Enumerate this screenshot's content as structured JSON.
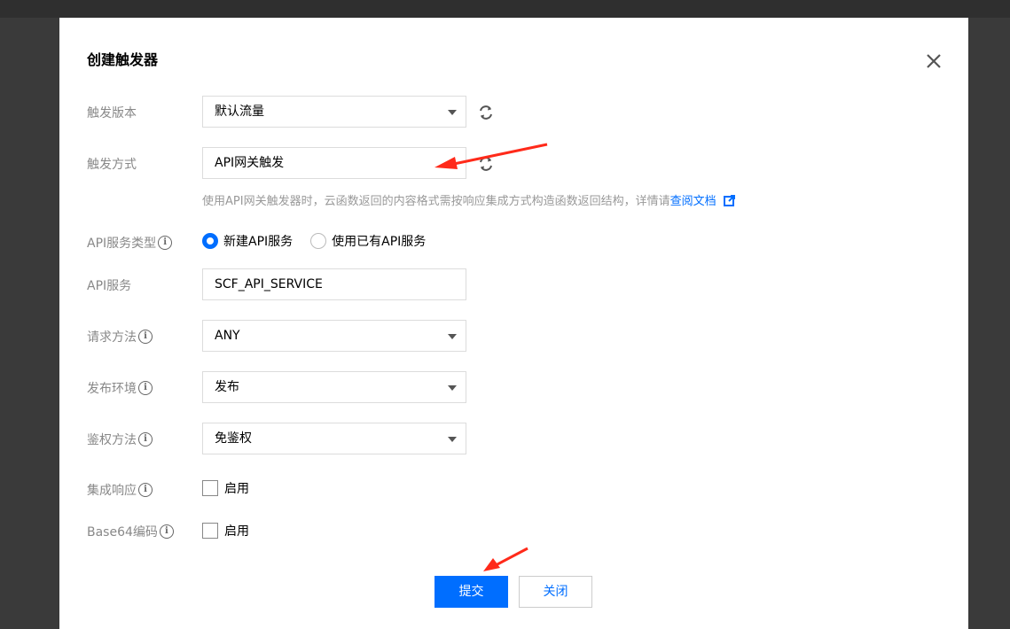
{
  "dialog": {
    "title": "创建触发器",
    "close_icon": "close-icon"
  },
  "form": {
    "trigger_version": {
      "label": "触发版本",
      "value": "默认流量"
    },
    "trigger_method": {
      "label": "触发方式",
      "value": "API网关触发"
    },
    "hint": {
      "text": "使用API网关触发器时，云函数返回的内容格式需按响应集成方式构造函数返回结构，详情请",
      "link": "查阅文档"
    },
    "api_service_type": {
      "label": "API服务类型",
      "options": [
        "新建API服务",
        "使用已有API服务"
      ],
      "selected": "新建API服务"
    },
    "api_service": {
      "label": "API服务",
      "value": "SCF_API_SERVICE"
    },
    "request_method": {
      "label": "请求方法",
      "value": "ANY"
    },
    "publish_env": {
      "label": "发布环境",
      "value": "发布"
    },
    "auth_method": {
      "label": "鉴权方法",
      "value": "免鉴权"
    },
    "integration_response": {
      "label": "集成响应",
      "checkbox_label": "启用",
      "checked": false
    },
    "base64": {
      "label": "Base64编码",
      "checkbox_label": "启用",
      "checked": false
    }
  },
  "buttons": {
    "submit": "提交",
    "close": "关闭"
  },
  "colors": {
    "accent": "#006eff",
    "annotation": "#ff2a1a"
  }
}
